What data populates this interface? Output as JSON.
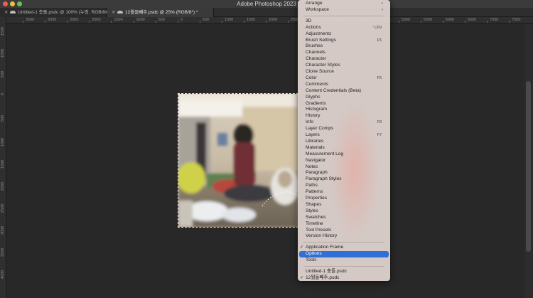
{
  "window": {
    "title": "Adobe Photoshop 2023"
  },
  "tabs": [
    {
      "label": "Untitled-1 충돌.psdc @ 100% (누렁, RGB/8#)",
      "active": false
    },
    {
      "label": "12월들빼주.psdc @ 25% (RGB/8*) *",
      "active": true
    }
  ],
  "ruler_top": [
    "3500",
    "3000",
    "2500",
    "2000",
    "1500",
    "1000",
    "500",
    "0",
    "500",
    "1000",
    "1500",
    "2000",
    "2500",
    "3000",
    "3500",
    "4000",
    "4500",
    "5000",
    "5500",
    "6000",
    "6500",
    "7000",
    "7500"
  ],
  "ruler_left": [
    "1500",
    "1000",
    "500",
    "0",
    "500",
    "1000",
    "1500",
    "2000",
    "2500",
    "3000",
    "3500",
    "4000"
  ],
  "menu": {
    "top_items": [
      {
        "label": "Arrange",
        "submenu": true
      },
      {
        "label": "Workspace",
        "submenu": true
      }
    ],
    "panels": [
      {
        "label": "3D",
        "shortcut": ""
      },
      {
        "label": "Actions",
        "shortcut": "⌥F9"
      },
      {
        "label": "Adjustments",
        "shortcut": ""
      },
      {
        "label": "Brush Settings",
        "shortcut": "F5"
      },
      {
        "label": "Brushes",
        "shortcut": ""
      },
      {
        "label": "Channels",
        "shortcut": ""
      },
      {
        "label": "Character",
        "shortcut": ""
      },
      {
        "label": "Character Styles",
        "shortcut": ""
      },
      {
        "label": "Clone Source",
        "shortcut": ""
      },
      {
        "label": "Color",
        "shortcut": "F6"
      },
      {
        "label": "Comments",
        "shortcut": ""
      },
      {
        "label": "Content Credentials (Beta)",
        "shortcut": ""
      },
      {
        "label": "Glyphs",
        "shortcut": ""
      },
      {
        "label": "Gradients",
        "shortcut": ""
      },
      {
        "label": "Histogram",
        "shortcut": ""
      },
      {
        "label": "History",
        "shortcut": ""
      },
      {
        "label": "Info",
        "shortcut": "F8"
      },
      {
        "label": "Layer Comps",
        "shortcut": ""
      },
      {
        "label": "Layers",
        "shortcut": "F7"
      },
      {
        "label": "Libraries",
        "shortcut": ""
      },
      {
        "label": "Materials",
        "shortcut": ""
      },
      {
        "label": "Measurement Log",
        "shortcut": ""
      },
      {
        "label": "Navigator",
        "shortcut": ""
      },
      {
        "label": "Notes",
        "shortcut": ""
      },
      {
        "label": "Paragraph",
        "shortcut": ""
      },
      {
        "label": "Paragraph Styles",
        "shortcut": ""
      },
      {
        "label": "Paths",
        "shortcut": ""
      },
      {
        "label": "Patterns",
        "shortcut": ""
      },
      {
        "label": "Properties",
        "shortcut": ""
      },
      {
        "label": "Shapes",
        "shortcut": ""
      },
      {
        "label": "Styles",
        "shortcut": ""
      },
      {
        "label": "Swatches",
        "shortcut": ""
      },
      {
        "label": "Timeline",
        "shortcut": ""
      },
      {
        "label": "Tool Presets",
        "shortcut": ""
      },
      {
        "label": "Version History",
        "shortcut": ""
      }
    ],
    "frame_items": [
      {
        "label": "Application Frame",
        "checked": true,
        "selected": false
      },
      {
        "label": "Options",
        "checked": false,
        "selected": true
      },
      {
        "label": "Tools",
        "checked": false,
        "selected": false
      }
    ],
    "documents": [
      {
        "label": "Untitled-1 충돌.psdc",
        "checked": false
      },
      {
        "label": "12월들빼주.psdc",
        "checked": true
      }
    ]
  },
  "colors": {
    "menu_highlight": "#2f6fd6",
    "canvas_bg": "#282828",
    "titlebar_bg": "#3b3b3b"
  },
  "icons": {
    "close_button": "red-traffic-light-icon",
    "minimize_button": "yellow-traffic-light-icon",
    "zoom_button": "green-traffic-light-icon",
    "cloud_document": "cloud-icon",
    "check": "checkmark-icon",
    "submenu": "chevron-right-icon"
  }
}
